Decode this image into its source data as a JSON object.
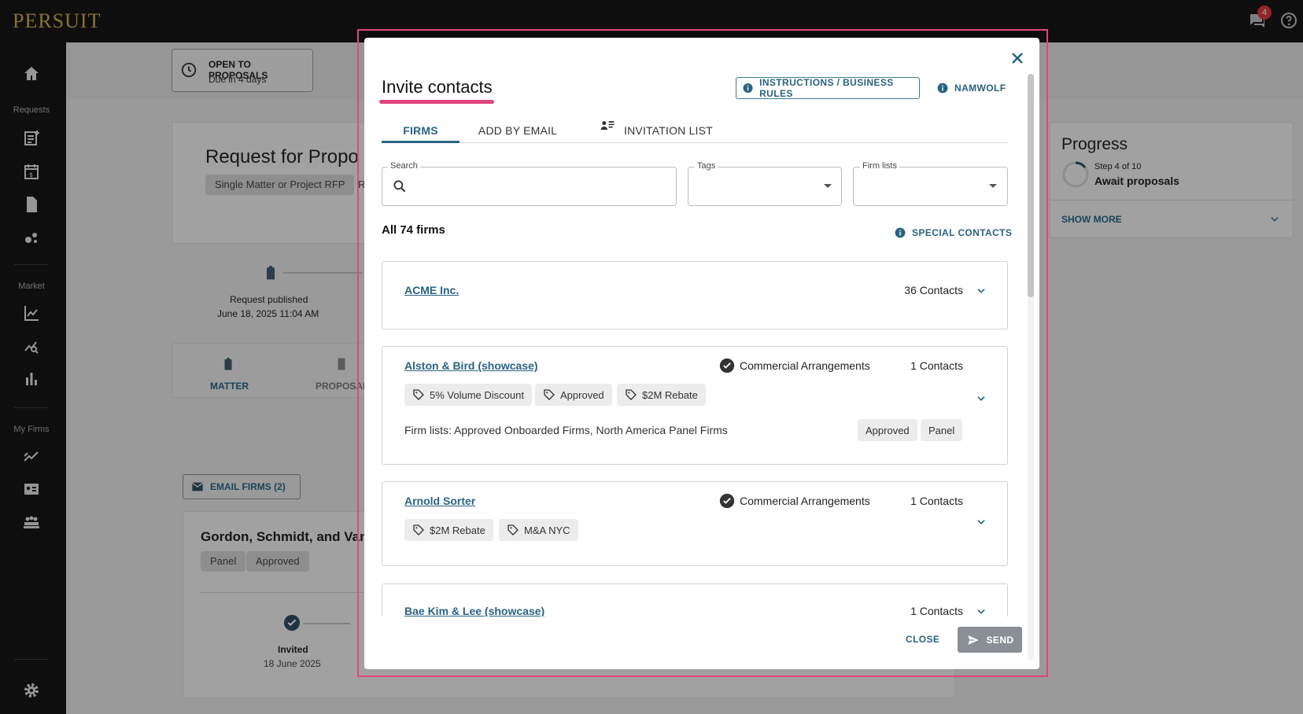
{
  "app": {
    "logo": "PERSUIT",
    "notification_count": "4"
  },
  "sidebar": {
    "sections": [
      "Requests",
      "Market",
      "My Firms"
    ]
  },
  "background": {
    "status_title": "OPEN TO PROPOSALS",
    "status_sub": "Due in 4 days",
    "request_title": "Request for Propo",
    "request_type_chip": "Single Matter or Project RFP",
    "request_chip_cut": "R",
    "timeline_label": "Request published",
    "timeline_date": "June 18, 2025 11:04 AM",
    "tab_matter": "MATTER",
    "tab_proposals": "PROPOSAL",
    "email_firms": "EMAIL FIRMS (2)",
    "firm_card_title": "Gordon, Schmidt, and Van",
    "firm_card_chips": [
      "Panel",
      "Approved"
    ],
    "invited_label": "Invited",
    "invited_date": "18 June 2025",
    "progress_title": "Progress",
    "progress_step": "Step 4 of 10",
    "progress_stage": "Await proposals",
    "show_more": "SHOW MORE"
  },
  "modal": {
    "title": "Invite contacts",
    "instructions_button": "INSTRUCTIONS / BUSINESS RULES",
    "namwolf_button": "NAMWOLF",
    "tabs": [
      "FIRMS",
      "ADD BY EMAIL",
      "INVITATION LIST"
    ],
    "search_label": "Search",
    "search_placeholder": "",
    "tags_label": "Tags",
    "firm_lists_label": "Firm lists",
    "firm_count": "All 74 firms",
    "special_contacts": "SPECIAL CONTACTS",
    "firms": [
      {
        "name": "ACME Inc.",
        "contacts": "36 Contacts"
      },
      {
        "name": "Alston & Bird (showcase)",
        "status": "Commercial Arrangements",
        "contacts": "1 Contacts",
        "tags": [
          "5% Volume Discount",
          "Approved",
          "$2M Rebate"
        ],
        "firm_lists": "Firm lists: Approved Onboarded Firms, North America Panel Firms",
        "list_chips": [
          "Approved",
          "Panel"
        ]
      },
      {
        "name": "Arnold Sorter",
        "status": "Commercial Arrangements",
        "contacts": "1 Contacts",
        "tags": [
          "$2M Rebate",
          "M&A NYC"
        ]
      },
      {
        "name": "Bae Kim & Lee (showcase)",
        "contacts": "1 Contacts"
      }
    ],
    "close_button": "CLOSE",
    "send_button": "SEND"
  },
  "colors": {
    "accent": "#2a6384",
    "highlight": "#e2457e",
    "sidebar": "#161616",
    "logo": "#c9a94b"
  }
}
